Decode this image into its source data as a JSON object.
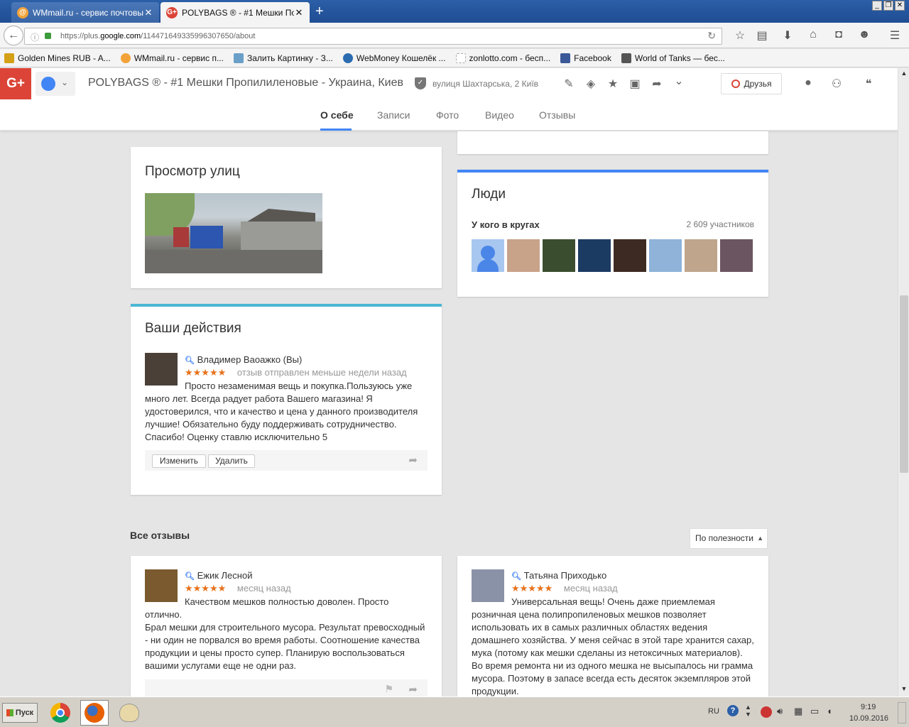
{
  "browser": {
    "tabs": [
      {
        "title": "WMmail.ru - сервис почтовы...",
        "active": false,
        "favicon": "at-icon"
      },
      {
        "title": "POLYBAGS ® - #1 Мешки По...",
        "active": true,
        "favicon": "gplus-icon"
      }
    ],
    "url_prefix": "https://plus.",
    "url_domain": "google.com",
    "url_path": "/114471649335996307650/about",
    "bookmarks": [
      {
        "label": "Golden Mines RUB - A...",
        "color": "#d4a017"
      },
      {
        "label": "WMmail.ru - сервис п...",
        "color": "#f2a33a"
      },
      {
        "label": "Залить Картинку - З...",
        "color": "#6aa0c8"
      },
      {
        "label": "WebMoney Кошелёк ...",
        "color": "#2b6cb0"
      },
      {
        "label": "zonlotto.com - бесп...",
        "color": "#b0b0b0"
      },
      {
        "label": "Facebook",
        "color": "#3b5998"
      },
      {
        "label": "World of Tanks — бес...",
        "color": "#555555"
      }
    ]
  },
  "gplus": {
    "logo": "G+",
    "page_title": "POLYBAGS ® - #1 Мешки Пропилиленовые - Украина, Киев",
    "address": "вулиця Шахтарська, 2 Київ",
    "friends_button": "Друзья",
    "tabs": [
      "О себе",
      "Записи",
      "Фото",
      "Видео",
      "Отзывы"
    ],
    "active_tab": 0
  },
  "streetview": {
    "title": "Просмотр улиц"
  },
  "people": {
    "title": "Люди",
    "circles_label": "У кого в кругах",
    "count": "2 609 участников",
    "avatar_colors": [
      "#4a86e8",
      "#c9a28a",
      "#3b4d2f",
      "#1c3b63",
      "#3d2a22",
      "#8fb3d9",
      "#bfa58c",
      "#6b5560"
    ]
  },
  "my_actions": {
    "title": "Ваши действия",
    "reviewer": "Владимер Ваоажко (Вы)",
    "stars": "★★★★★",
    "time": "отзыв отправлен меньше недели назад",
    "text": " Просто незаменимая вещь и покупка.Пользуюсь уже много лет. Всегда радует работа Вашего магазина! Я удостоверился, что и качество и цена у данного производителя лучшие! Обязательно буду поддерживать сотрудничество. Спасибо! Оценку ставлю исключительно 5",
    "edit_button": "Изменить",
    "delete_button": "Удалить"
  },
  "all_reviews": {
    "title": "Все отзывы",
    "sort_label": "По полезности",
    "reviews": [
      {
        "author": "Ежик Лесной",
        "stars": "★★★★★",
        "time": "месяц назад",
        "lines": [
          " Качеством мешков полностью доволен. Просто отлично.",
          "Брал мешки для строительного мусора. Результат превосходный - ни один не порвался во время работы. Соотношение качества продукции и цены просто супер. Планирую воспользоваться вашими услугами еще не одни раз."
        ]
      },
      {
        "author": "Татьяна Приходько",
        "stars": "★★★★★",
        "time": "месяц назад",
        "lines": [
          " Универсальная вещь! Очень даже приемлемая розничная цена полипропиленовых мешков позволяет использовать их в самых различных областях ведения домашнего хозяйства. У меня сейчас в этой таре хранится сахар, мука (потому как мешки сделаны из нетоксичных материалов). Во время ремонта ни из одного мешка не высыпалось ни грамма мусора. Поэтому в запасе всегда есть десяток экземпляров этой продукции."
        ]
      }
    ]
  },
  "taskbar": {
    "start_label": "Пуск",
    "lang": "RU",
    "time": "9:19",
    "date": "10.09.2016"
  },
  "colors": {
    "gplus_red": "#db4437",
    "accent_blue": "#4285f4",
    "star_orange": "#e7711b",
    "actions_card_border": "#4ab7d3"
  }
}
